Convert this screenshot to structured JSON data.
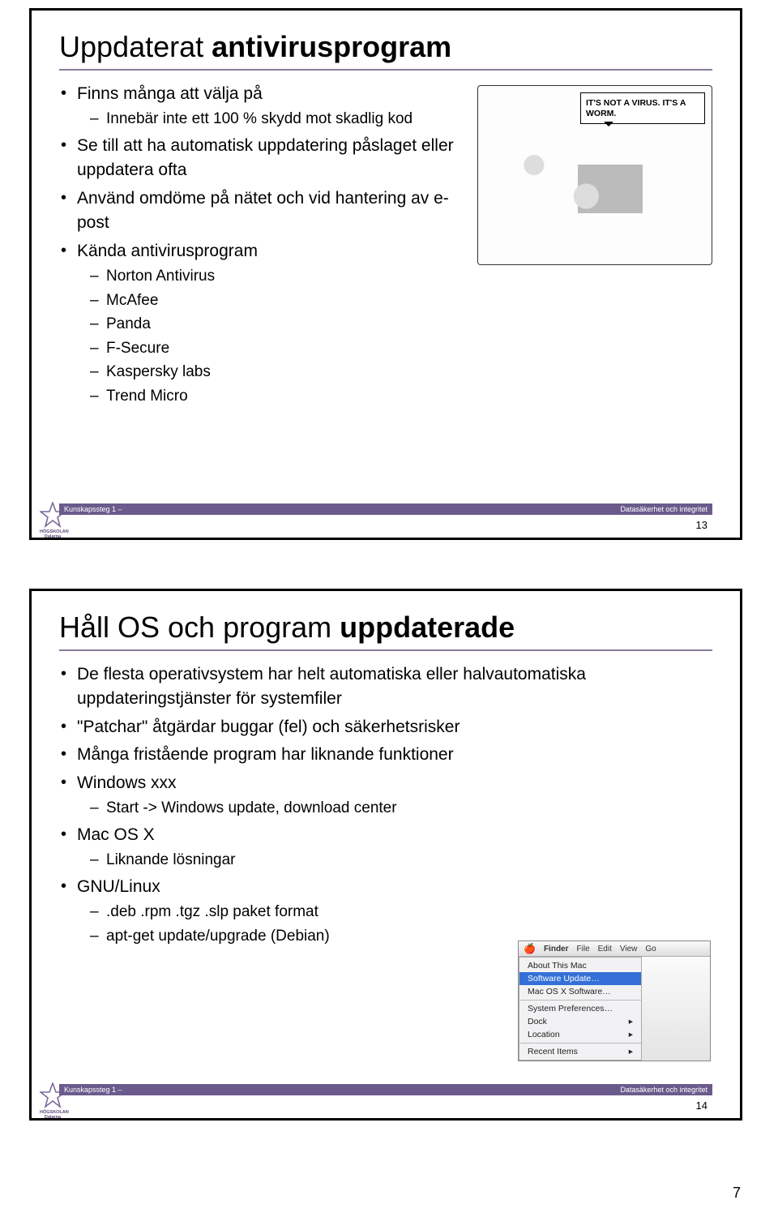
{
  "page_number": "7",
  "slides": [
    {
      "title_plain": "Uppdaterat ",
      "title_bold": "antivirusprogram",
      "footer_left": "Kunskapssteg 1 –",
      "footer_right": "Datasäkerhet och integritet",
      "slide_number": "13",
      "logo_text": "HÖGSKOLAN\nDalarna",
      "cartoon_speech": "IT'S NOT A VIRUS. IT'S A WORM.",
      "bullets": [
        {
          "text": "Finns många att välja på",
          "sub": [
            "Innebär inte ett 100 % skydd mot skadlig kod"
          ]
        },
        {
          "text": "Se till att ha automatisk uppdatering påslaget eller uppdatera ofta"
        },
        {
          "text": "Använd omdöme på nätet och vid hantering av e-post"
        },
        {
          "text": "Kända antivirusprogram",
          "sub": [
            "Norton Antivirus",
            "McAfee",
            "Panda",
            "F-Secure",
            "Kaspersky labs",
            "Trend Micro"
          ]
        }
      ]
    },
    {
      "title_plain": "Håll OS och program ",
      "title_bold": "uppdaterade",
      "footer_left": "Kunskapssteg 1 –",
      "footer_right": "Datasäkerhet och integritet",
      "slide_number": "14",
      "logo_text": "HÖGSKOLAN\nDalarna",
      "mac_menu": {
        "bar": [
          "Finder",
          "File",
          "Edit",
          "View",
          "Go"
        ],
        "items": [
          "About This Mac",
          "Software Update…",
          "Mac OS X Software…",
          "System Preferences…",
          "Dock",
          "Location",
          "Recent Items"
        ],
        "selected_index": 1
      },
      "bullets": [
        {
          "text": "De flesta operativsystem har helt automatiska eller halvautomatiska uppdateringstjänster för systemfiler"
        },
        {
          "text": "\"Patchar\" åtgärdar buggar (fel) och säkerhetsrisker"
        },
        {
          "text": "Många fristående program har liknande funktioner"
        },
        {
          "text": "Windows xxx",
          "sub": [
            "Start -> Windows update, download center"
          ]
        },
        {
          "text": "Mac OS X",
          "sub": [
            "Liknande lösningar"
          ]
        },
        {
          "text": "GNU/Linux",
          "sub": [
            ".deb .rpm .tgz .slp paket format",
            "apt-get update/upgrade (Debian)"
          ]
        }
      ]
    }
  ]
}
